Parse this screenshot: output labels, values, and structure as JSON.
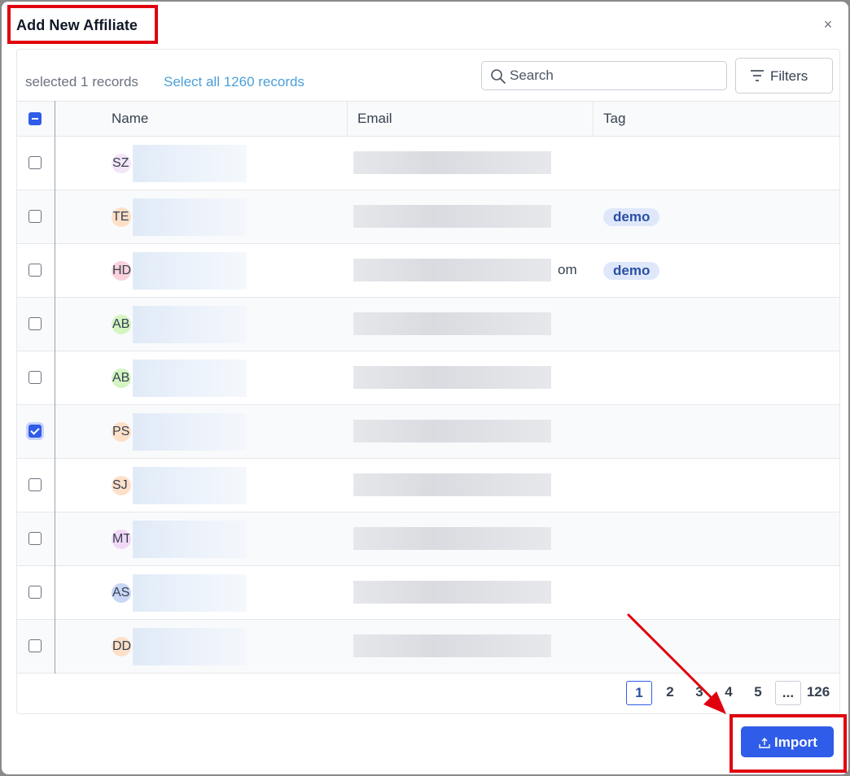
{
  "modal": {
    "title": "Add New Affiliate",
    "close_glyph": "×"
  },
  "toolbar": {
    "selected_text": "selected 1 records",
    "select_all_text": "Select all 1260 records",
    "search_placeholder": "Search",
    "filters_label": "Filters"
  },
  "table": {
    "columns": [
      "Name",
      "Email",
      "Tag"
    ],
    "rows": [
      {
        "initials": "SZ",
        "avatar_color": "#f3e6f7",
        "checked": false,
        "email_tail": "",
        "tag": ""
      },
      {
        "initials": "TE",
        "avatar_color": "#fde0c7",
        "checked": false,
        "email_tail": "",
        "tag": "demo"
      },
      {
        "initials": "HD",
        "avatar_color": "#f9d2dc",
        "checked": false,
        "email_tail": "om",
        "tag": "demo"
      },
      {
        "initials": "AB",
        "avatar_color": "#d4f5c2",
        "checked": false,
        "email_tail": "",
        "tag": ""
      },
      {
        "initials": "AB",
        "avatar_color": "#d4f5c2",
        "checked": false,
        "email_tail": "",
        "tag": ""
      },
      {
        "initials": "PS",
        "avatar_color": "#fde0c7",
        "checked": true,
        "email_tail": "",
        "tag": ""
      },
      {
        "initials": "SJ",
        "avatar_color": "#fde0c7",
        "checked": false,
        "email_tail": "",
        "tag": ""
      },
      {
        "initials": "MT",
        "avatar_color": "#f1d8f7",
        "checked": false,
        "email_tail": "",
        "tag": ""
      },
      {
        "initials": "AS",
        "avatar_color": "#c9d6f5",
        "checked": false,
        "email_tail": "",
        "tag": ""
      },
      {
        "initials": "DD",
        "avatar_color": "#fde0c7",
        "checked": false,
        "email_tail": "",
        "tag": ""
      }
    ]
  },
  "pagination": {
    "pages": [
      "1",
      "2",
      "3",
      "4",
      "5"
    ],
    "ellipsis": "...",
    "last": "126",
    "current": "1"
  },
  "footer": {
    "import_label": "Import"
  },
  "colors": {
    "primary": "#2f5ce8",
    "highlight": "#e0000f",
    "link": "#4a9fd8"
  }
}
